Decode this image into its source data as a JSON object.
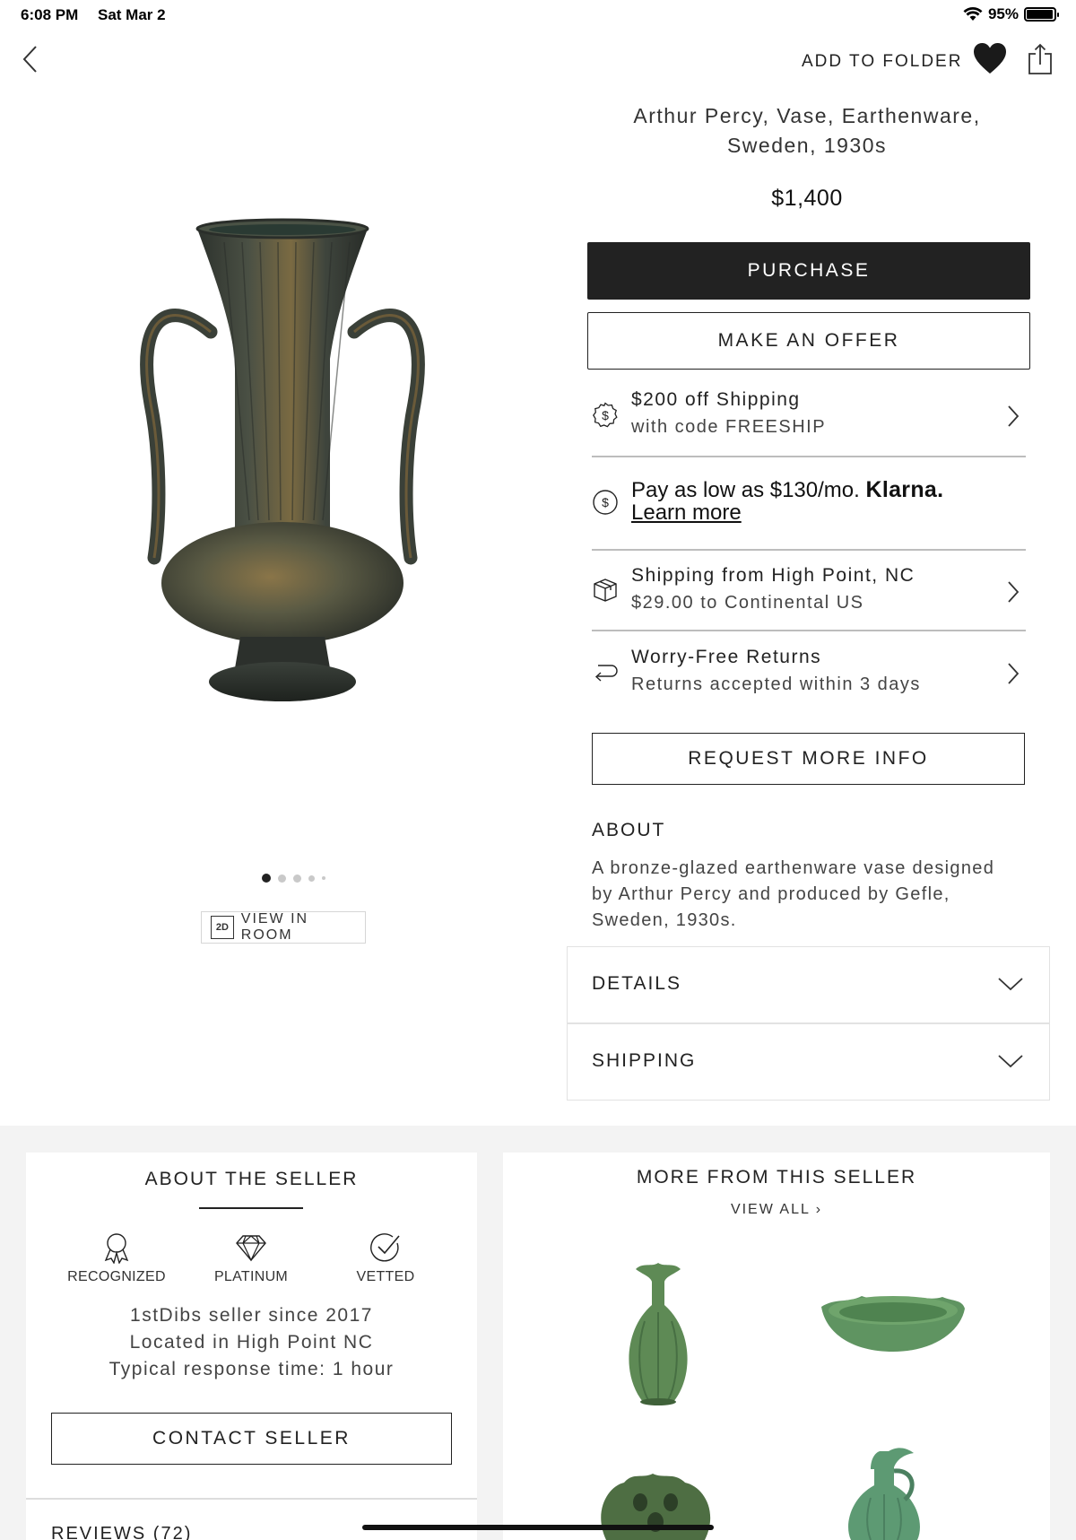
{
  "status_bar": {
    "time": "6:08 PM",
    "date": "Sat Mar 2",
    "battery": "95%",
    "battery_level": 0.95
  },
  "nav": {
    "add_to_folder": "ADD TO FOLDER"
  },
  "product": {
    "title": "Arthur Percy, Vase, Earthenware, Sweden, 1930s",
    "price": "$1,400",
    "carousel": {
      "count": 5,
      "active": 0
    },
    "view_in_room": "VIEW IN ROOM",
    "view_badge": "2D"
  },
  "actions": {
    "purchase": "PURCHASE",
    "offer": "MAKE AN OFFER",
    "request_info": "REQUEST MORE INFO"
  },
  "info_rows": {
    "promo": {
      "line1": "$200 off Shipping",
      "line2": "with code FREESHIP",
      "icon": "dollar-badge-icon"
    },
    "klarna": {
      "prefix": "Pay as low as $130/mo.",
      "brand": "Klarna.",
      "link": "Learn more",
      "icon": "dollar-circle-icon"
    },
    "shipping": {
      "line1": "Shipping from High Point, NC",
      "line2": "$29.00 to Continental US",
      "icon": "package-icon"
    },
    "returns": {
      "line1": "Worry-Free Returns",
      "line2": "Returns accepted within 3 days",
      "icon": "return-arrow-icon"
    }
  },
  "about": {
    "heading": "ABOUT",
    "text": "A bronze-glazed earthenware vase designed by Arthur Percy and produced by Gefle, Sweden, 1930s."
  },
  "accordions": {
    "details": "DETAILS",
    "shipping": "SHIPPING"
  },
  "seller": {
    "title": "ABOUT THE SELLER",
    "badges": {
      "recognized": "RECOGNIZED",
      "platinum": "PLATINUM",
      "vetted": "VETTED"
    },
    "since": "1stDibs seller since 2017",
    "location": "Located in High Point NC",
    "response": "Typical response time: 1 hour",
    "contact": "CONTACT SELLER",
    "reviews": "REVIEWS (72)"
  },
  "more": {
    "title": "MORE FROM THIS SELLER",
    "view_all": "VIEW ALL"
  },
  "colors": {
    "button_dark": "#222222",
    "vase_bronze": "#3d4339",
    "celadon_green": "#5f8a5a",
    "section_bg": "#f3f3f3"
  }
}
